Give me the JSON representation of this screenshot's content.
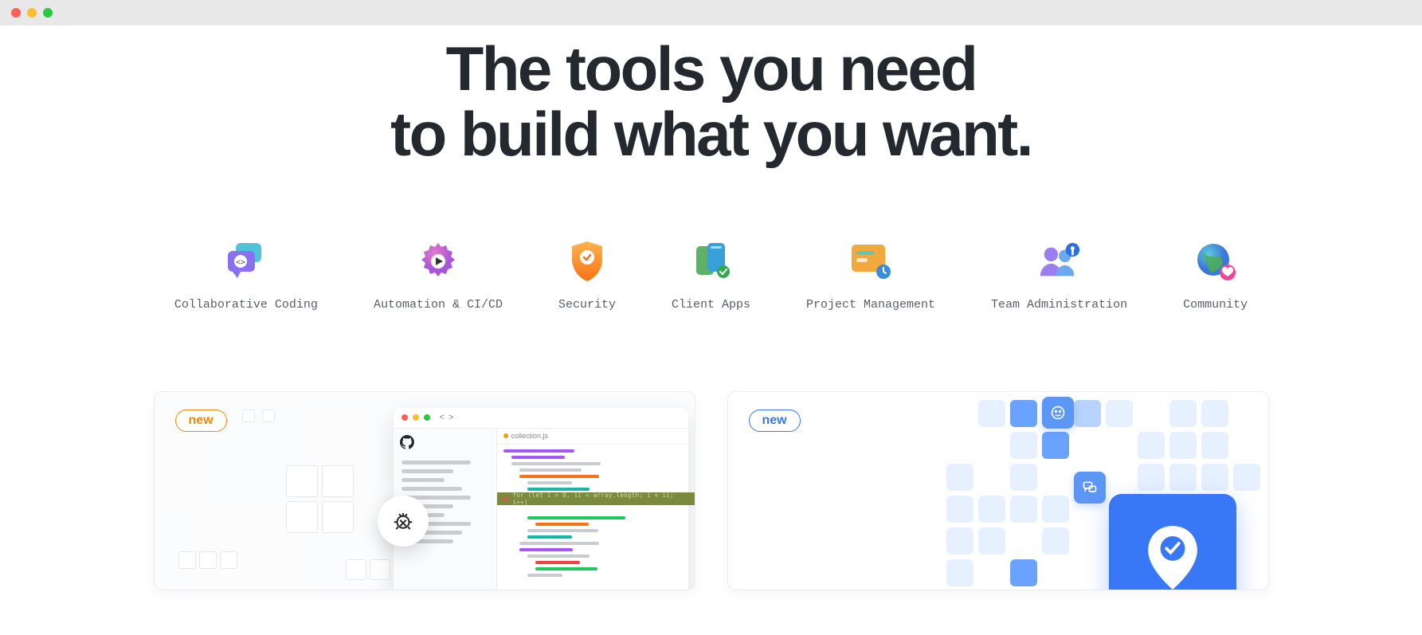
{
  "headline_line1": "The tools you need",
  "headline_line2": "to build what you want.",
  "categories": [
    {
      "label": "Collaborative Coding",
      "icon": "chat-code"
    },
    {
      "label": "Automation & CI/CD",
      "icon": "gear-play"
    },
    {
      "label": "Security",
      "icon": "shield-check"
    },
    {
      "label": "Client Apps",
      "icon": "apps"
    },
    {
      "label": "Project Management",
      "icon": "board-clock"
    },
    {
      "label": "Team Administration",
      "icon": "people-key"
    },
    {
      "label": "Community",
      "icon": "globe-heart"
    }
  ],
  "cards": [
    {
      "badge": "new",
      "badge_color": "orange",
      "illustration": "codespaces-editor",
      "file_tab": "collection.js",
      "highlight_code": "for (let i = 0, ii = array.length; i < ii; i++)"
    },
    {
      "badge": "new",
      "badge_color": "blue",
      "illustration": "discussions-grid"
    }
  ]
}
